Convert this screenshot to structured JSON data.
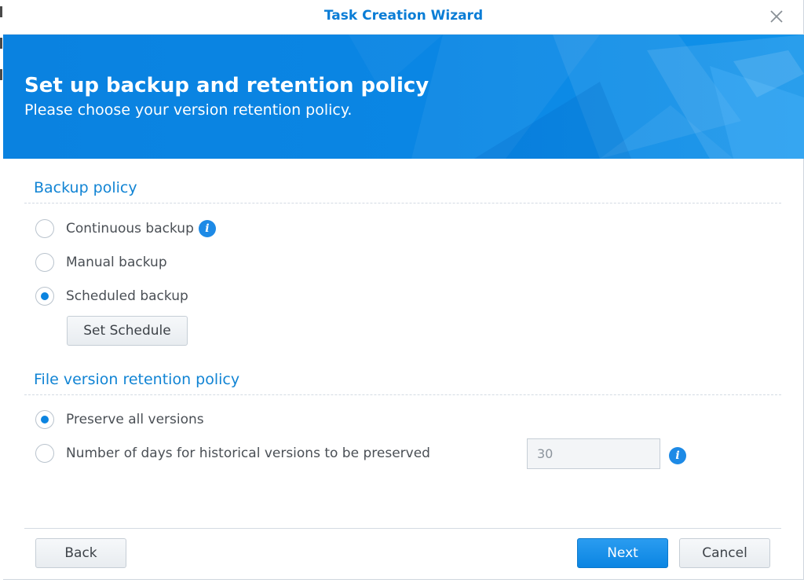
{
  "window": {
    "title": "Task Creation Wizard"
  },
  "banner": {
    "heading": "Set up backup and retention policy",
    "subheading": "Please choose your version retention policy."
  },
  "backup_policy": {
    "title": "Backup policy",
    "options": [
      {
        "label": "Continuous backup",
        "checked": false,
        "info_icon": "info-icon"
      },
      {
        "label": "Manual backup",
        "checked": false
      },
      {
        "label": "Scheduled backup",
        "checked": true
      }
    ],
    "set_schedule_label": "Set Schedule"
  },
  "retention_policy": {
    "title": "File version retention policy",
    "options": [
      {
        "label": "Preserve all versions",
        "checked": true
      },
      {
        "label": "Number of days for historical versions to be preserved",
        "checked": false
      }
    ],
    "days_value": "30",
    "info_icon": "info-icon"
  },
  "footer": {
    "back_label": "Back",
    "next_label": "Next",
    "cancel_label": "Cancel"
  },
  "colors": {
    "accent": "#0b84e0",
    "title_text": "#0a7dd6",
    "section_title": "#1184d4",
    "banner": "#0a86e4"
  }
}
